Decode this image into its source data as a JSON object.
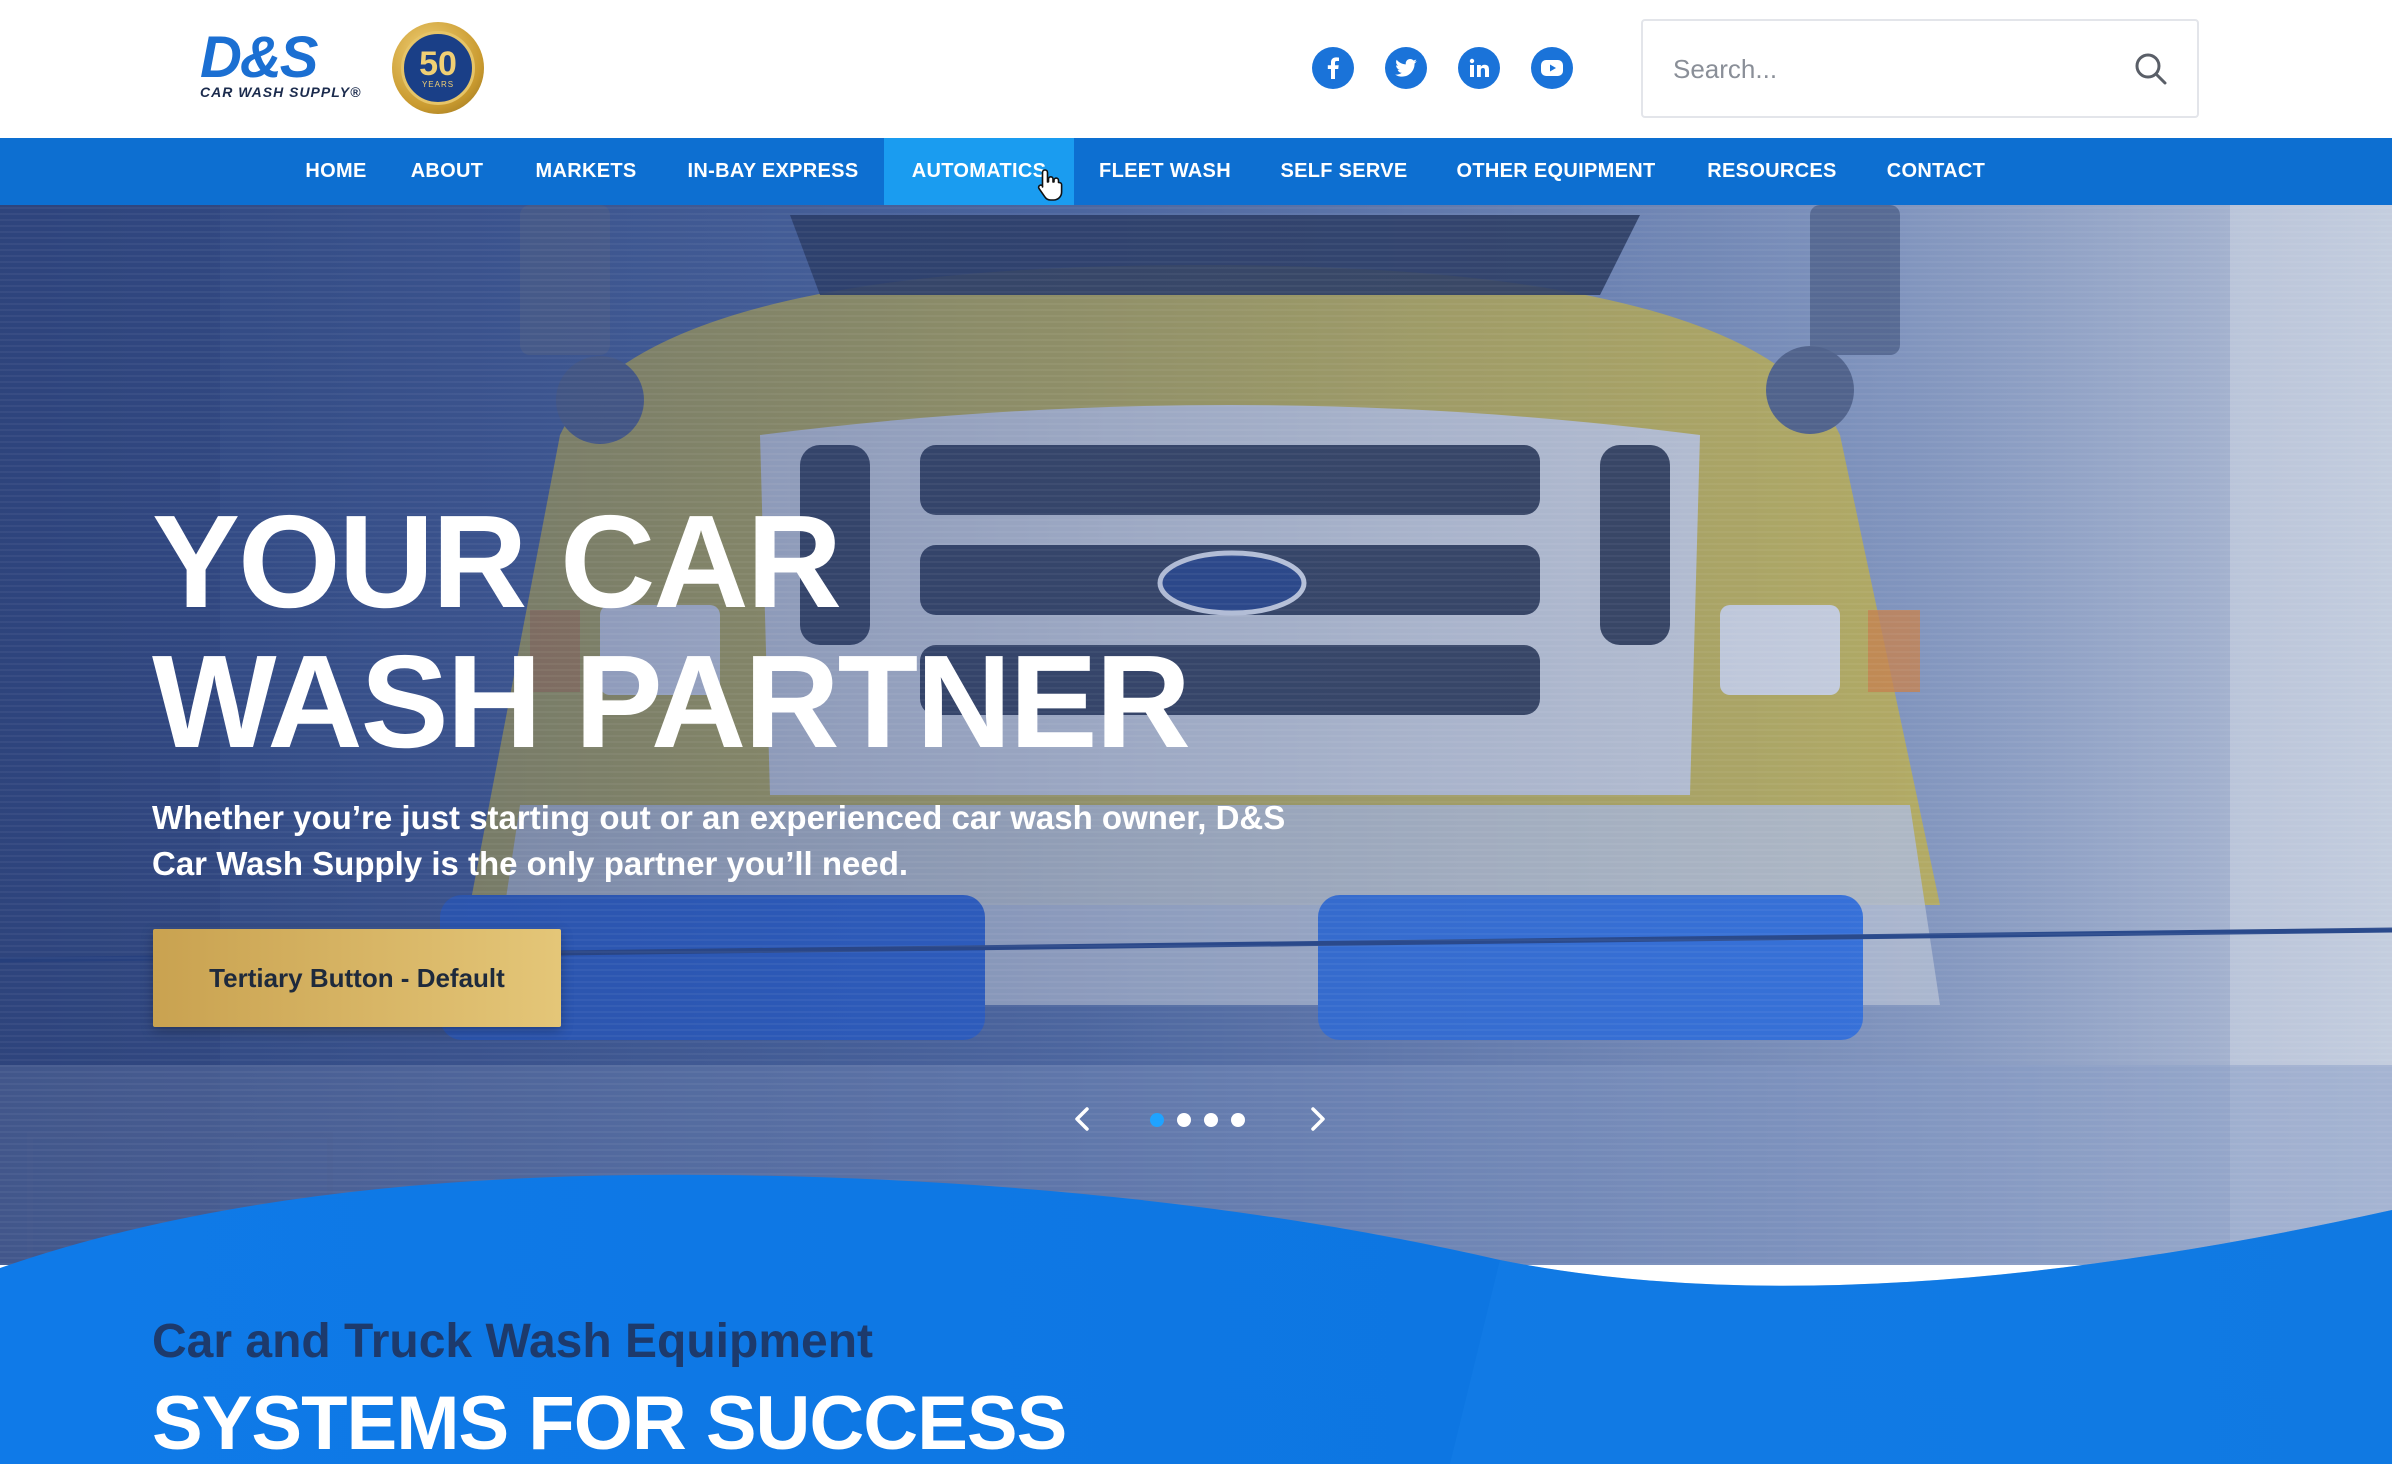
{
  "brand": {
    "logo_text": "D&S",
    "logo_subtext": "CAR WASH SUPPLY®",
    "anniversary_number": "50",
    "anniversary_label": "YEARS"
  },
  "socials": [
    {
      "name": "facebook",
      "icon": "facebook-icon"
    },
    {
      "name": "twitter",
      "icon": "twitter-icon"
    },
    {
      "name": "linkedin",
      "icon": "linkedin-icon"
    },
    {
      "name": "youtube",
      "icon": "youtube-icon"
    }
  ],
  "search": {
    "placeholder": "Search...",
    "value": ""
  },
  "nav": {
    "items": [
      {
        "label": "HOME"
      },
      {
        "label": "ABOUT"
      },
      {
        "label": "MARKETS"
      },
      {
        "label": "IN-BAY EXPRESS"
      },
      {
        "label": "AUTOMATICS"
      },
      {
        "label": "FLEET WASH"
      },
      {
        "label": "SELF SERVE"
      },
      {
        "label": "OTHER EQUIPMENT"
      },
      {
        "label": "RESOURCES"
      },
      {
        "label": "CONTACT"
      }
    ],
    "active": "AUTOMATICS"
  },
  "hero": {
    "title_line1": "YOUR CAR",
    "title_line2": "WASH PARTNER",
    "subtitle_line1": "Whether you’re just starting out or an experienced car wash owner, D&S",
    "subtitle_line2": "Car Wash Supply is the only partner you’ll need.",
    "button_label": "Tertiary Button - Default",
    "slides_total": 4,
    "active_slide": 1
  },
  "section": {
    "kicker": "Car and Truck Wash Equipment",
    "title": "SYSTEMS FOR SUCCESS"
  },
  "colors": {
    "nav_blue": "#0d6fd1",
    "nav_active": "#1a9cf0",
    "social_blue": "#1a73d9",
    "button_gold": "#d6b466",
    "section_blue": "#0f78e6",
    "kicker_navy": "#1d3a6c",
    "dot_active": "#1fa3ff"
  }
}
